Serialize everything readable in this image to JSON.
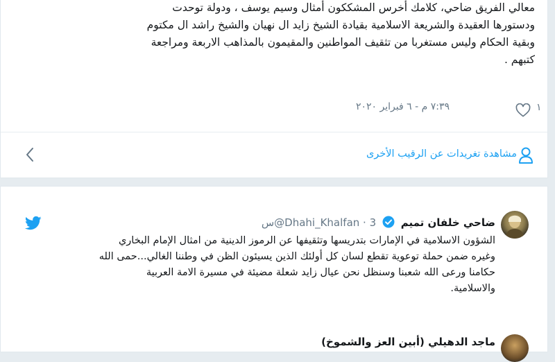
{
  "tweet1": {
    "lines": [
      "معالي الفريق ضاحي، كلامك أخرس المشككون أمثال وسيم يوسف ، ودولة توحدت",
      "ودستورها العقيدة والشريعة الاسلامية بقيادة الشيخ زايد ال نهيان والشيخ راشد ال مكتوم",
      "وبقية الحكام وليس مستغربا من تثقيف المواطنين والمقيمون بالمذاهب الاربعة ومراجعة",
      "كتبهم ."
    ],
    "like_count": "١",
    "timestamp": "٧:٣٩ م - ٦ فبراير ٢٠٢٠",
    "view_other_label": "مشاهدة تغريدات عن الرقيب الأخرى"
  },
  "tweet2": {
    "display_name": "ضاحي خلفان تميم",
    "handle": "@Dhahi_Khalfan",
    "time_ago": "3س",
    "lines": [
      "الشؤون الاسلامية في الإمارات بتدريسها وتثقيفها عن الرموز الدينية من امثال الإمام البخاري",
      "وغيره ضمن حملة توعوية تقطع لسان كل أولئك الذين يسيئون الظن في وطننا الغالي...حمى الله",
      "حكامنا ورعى الله شعبنا وسنظل نحن عيال زايد شعلة مضيئة في مسيرة الامة العربية",
      "والاسلامية."
    ]
  },
  "reply": {
    "display_name": "ماجد الدهيلي (أبين العز والشموخ)"
  },
  "colors": {
    "accent": "#1da1f2",
    "verified": "#1da1f2",
    "text": "#14171a",
    "muted": "#657786"
  },
  "icons": [
    "heart-icon",
    "chevron-left-icon",
    "person-icon",
    "verified-badge-icon",
    "twitter-bird-icon"
  ]
}
